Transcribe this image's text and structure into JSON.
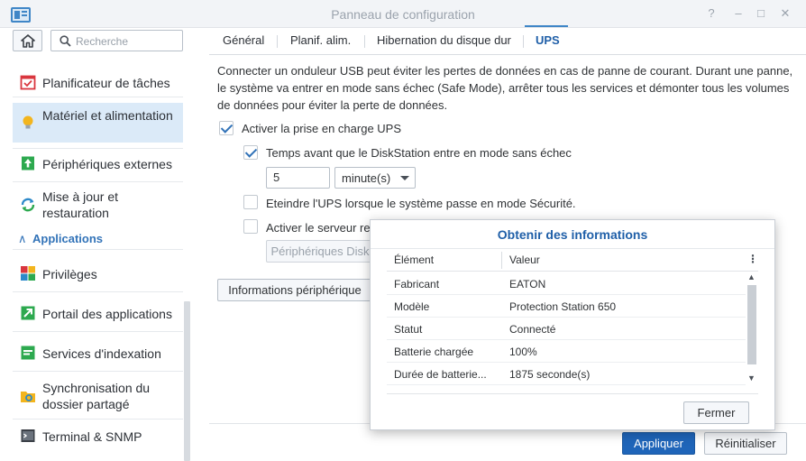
{
  "window": {
    "title": "Panneau de configuration",
    "controls": [
      "?",
      "–",
      "□",
      "✕"
    ]
  },
  "sidebar": {
    "search_placeholder": "Recherche",
    "items": [
      {
        "label": "Planificateur de tâches",
        "icon": "calendar-check-icon"
      },
      {
        "label": "Matériel et alimentation",
        "icon": "lightbulb-icon",
        "active": true
      },
      {
        "label": "Périphériques externes",
        "icon": "external-device-icon"
      },
      {
        "label": "Mise à jour et restauration",
        "icon": "update-restore-icon"
      }
    ],
    "section_title": "Applications",
    "app_items": [
      {
        "label": "Privilèges",
        "icon": "privileges-icon"
      },
      {
        "label": "Portail des applications",
        "icon": "app-portal-icon"
      },
      {
        "label": "Services d'indexation",
        "icon": "indexing-icon"
      },
      {
        "label": "Synchronisation du dossier partagé",
        "icon": "shared-folder-sync-icon"
      },
      {
        "label": "Terminal & SNMP",
        "icon": "terminal-icon"
      }
    ]
  },
  "tabs": [
    {
      "label": "Général"
    },
    {
      "label": "Planif. alim."
    },
    {
      "label": "Hibernation du disque dur"
    },
    {
      "label": "UPS",
      "active": true
    }
  ],
  "ups": {
    "description": "Connecter un onduleur USB peut éviter les pertes de données en cas de panne de courant. Durant une panne, le système va entrer en mode sans échec (Safe Mode), arrêter tous les services et démonter tous les volumes de données pour éviter la perte de données.",
    "enable_label": "Activer la prise en charge UPS",
    "enable_checked": true,
    "time_label": "Temps avant que le DiskStation entre en mode sans échec",
    "time_checked": true,
    "time_value": "5",
    "time_unit": "minute(s)",
    "shutdown_label": "Eteindre l'UPS lorsque le système passe en mode Sécurité.",
    "shutdown_checked": false,
    "server_label": "Activer le serveur re",
    "server_checked": false,
    "devices_button": "Périphériques Disk",
    "info_button": "Informations périphérique"
  },
  "footer": {
    "apply": "Appliquer",
    "reset": "Réinitialiser"
  },
  "modal": {
    "title": "Obtenir des informations",
    "col_element": "Élément",
    "col_value": "Valeur",
    "rows": [
      {
        "element": "Fabricant",
        "value": "EATON"
      },
      {
        "element": "Modèle",
        "value": "Protection Station 650"
      },
      {
        "element": "Statut",
        "value": "Connecté"
      },
      {
        "element": "Batterie chargée",
        "value": "100%"
      },
      {
        "element": "Durée de batterie...",
        "value": "1875 seconde(s)"
      }
    ],
    "close_button": "Fermer"
  },
  "colors": {
    "accent": "#1f65b9",
    "active_bg": "#dbeaf8",
    "title_blue": "#1f5fa8"
  }
}
